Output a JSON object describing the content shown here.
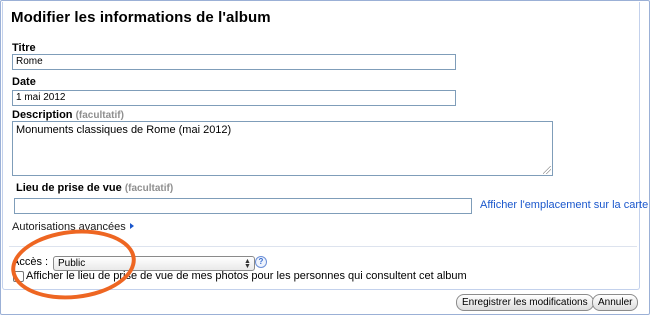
{
  "dialog": {
    "title": "Modifier les informations de l'album"
  },
  "fields": {
    "titre": {
      "label": "Titre",
      "value": "Rome"
    },
    "date": {
      "label": "Date",
      "value": "1 mai 2012"
    },
    "description": {
      "label": "Description",
      "optional": "(facultatif)",
      "value": "Monuments classiques de Rome (mai 2012)"
    },
    "lieu": {
      "label": "Lieu de prise de vue",
      "optional": "(facultatif)",
      "value": ""
    }
  },
  "links": {
    "map": "Afficher l'emplacement sur la carte",
    "advanced": "Autorisations avancées"
  },
  "access": {
    "label": "Accès :",
    "selected": "Public",
    "help": "?"
  },
  "location_checkbox": {
    "label": "Afficher le lieu de prise de vue de mes photos pour les personnes qui consultent cet album",
    "checked": false
  },
  "buttons": {
    "save": "Enregistrer les modifications",
    "cancel": "Annuler"
  },
  "colors": {
    "link": "#1a57cc",
    "annotation_circle": "#ee6622",
    "optional_text": "#8f8f8f"
  },
  "icons": {
    "dropdown": "chevron-updown-icon",
    "help": "help-circle-icon",
    "advanced_arrow": "triangle-right-icon"
  }
}
